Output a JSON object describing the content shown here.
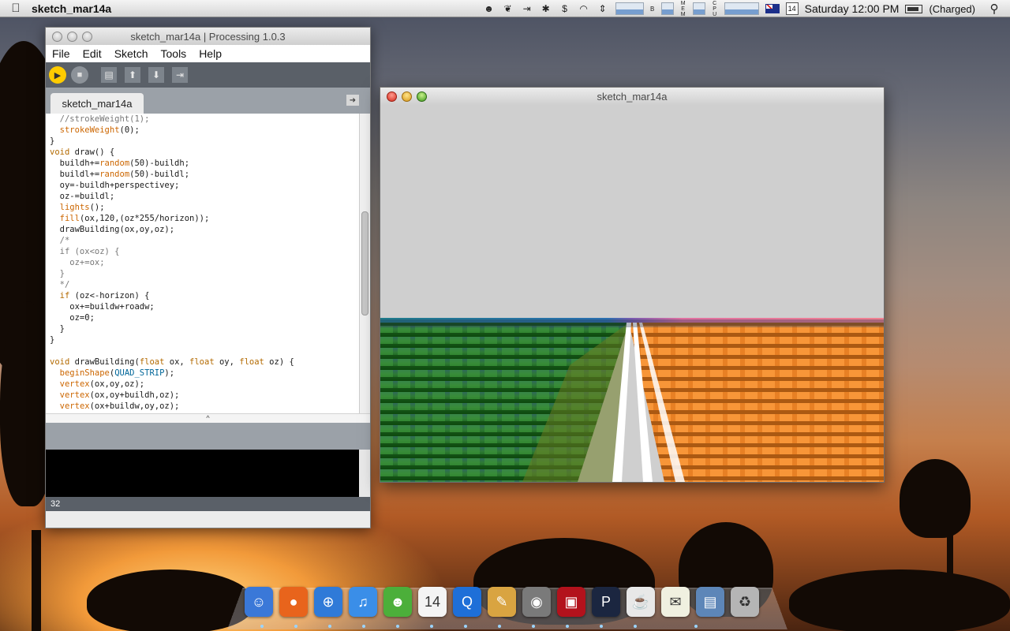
{
  "menubar": {
    "apple": "",
    "app_name": "sketch_mar14a",
    "calendar_day": "14",
    "clock": "Saturday 12:00 PM",
    "battery_status": "(Charged)",
    "graph_labels": [
      "B",
      "M",
      "E",
      "M",
      "C",
      "P",
      "U"
    ]
  },
  "ide": {
    "title": "sketch_mar14a | Processing 1.0.3",
    "menus": [
      "File",
      "Edit",
      "Sketch",
      "Tools",
      "Help"
    ],
    "tab_label": "sketch_mar14a",
    "line_number": "32",
    "code_lines": [
      "  //strokeWeight(1);",
      "  strokeWeight(0);",
      "}",
      "void draw() {",
      "  buildh+=random(50)-buildh;",
      "  buildl+=random(50)-buildl;",
      "  oy=-buildh+perspectivey;",
      "  oz-=buildl;",
      "  lights();",
      "  fill(ox,120,(oz*255/horizon));",
      "  drawBuilding(ox,oy,oz);",
      "  /*",
      "  if (ox<oz) {",
      "    oz+=ox;",
      "  }",
      "  */",
      "  if (oz<-horizon) {",
      "    ox+=buildw+roadw;",
      "    oz=0;",
      "  }",
      "}",
      "",
      "void drawBuilding(float ox, float oy, float oz) {",
      "  beginShape(QUAD_STRIP);",
      "  vertex(ox,oy,oz);",
      "  vertex(ox,oy+buildh,oz);",
      "  vertex(ox+buildw,oy,oz);",
      "  vertex(ox+buildw,oy+buildh,oz);"
    ],
    "toolbar": {
      "run": "▶",
      "stop": "■",
      "new": "▤",
      "open": "⬆",
      "save": "⬇",
      "export": "⇥",
      "tab_menu": "➜"
    }
  },
  "sketch_window": {
    "title": "sketch_mar14a"
  },
  "dock": {
    "apps": [
      {
        "name": "finder",
        "glyph": "☺",
        "color": "#3a78d8"
      },
      {
        "name": "firefox",
        "glyph": "●",
        "color": "#e8641c"
      },
      {
        "name": "safari",
        "glyph": "⊕",
        "color": "#2f7ad8"
      },
      {
        "name": "itunes",
        "glyph": "♫",
        "color": "#3a8ee8"
      },
      {
        "name": "adium",
        "glyph": "☻",
        "color": "#4caf3a"
      },
      {
        "name": "ical",
        "glyph": "14",
        "color": "#f4f4f4"
      },
      {
        "name": "quicktime",
        "glyph": "Q",
        "color": "#1e6fd8"
      },
      {
        "name": "preview",
        "glyph": "✎",
        "color": "#d9a441"
      },
      {
        "name": "iphoto",
        "glyph": "◉",
        "color": "#7a7a7a"
      },
      {
        "name": "photo-booth",
        "glyph": "▣",
        "color": "#b3121c"
      },
      {
        "name": "processing",
        "glyph": "P",
        "color": "#1b2640"
      },
      {
        "name": "coffee-app",
        "glyph": "☕",
        "color": "#e8e8e8"
      },
      {
        "name": "textedit",
        "glyph": "✉",
        "color": "#f0f0e0"
      },
      {
        "name": "system-app",
        "glyph": "▤",
        "color": "#5d86b8"
      },
      {
        "name": "trash",
        "glyph": "♻",
        "color": "#b5b5b5"
      }
    ]
  }
}
